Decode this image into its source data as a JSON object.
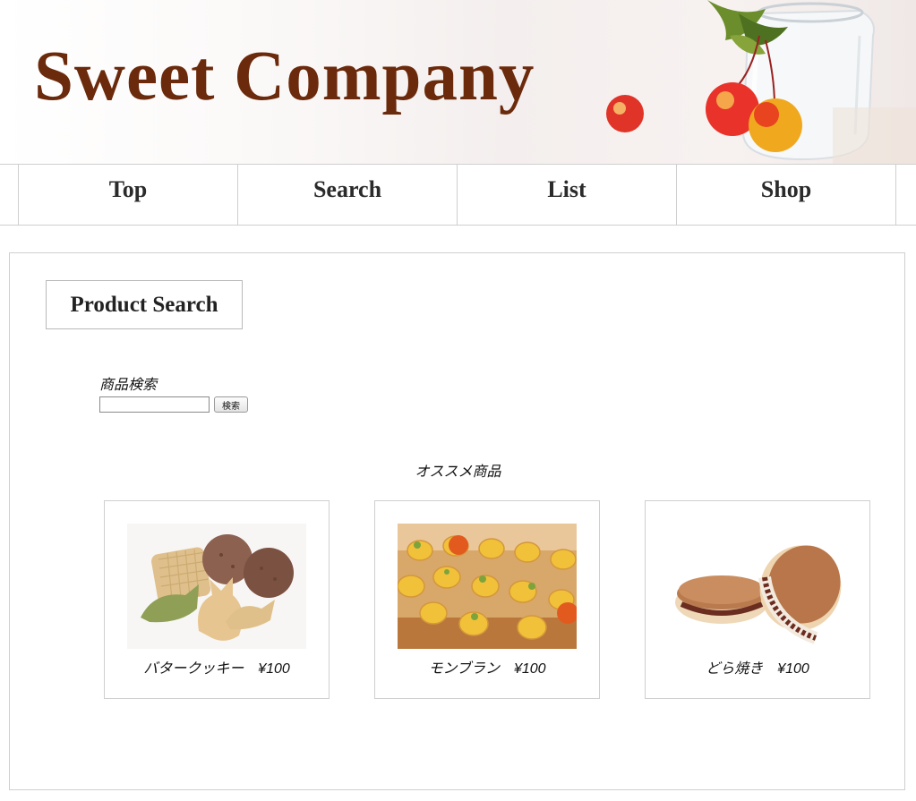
{
  "header": {
    "title": "Sweet Company"
  },
  "nav": {
    "items": [
      {
        "label": "Top"
      },
      {
        "label": "Search"
      },
      {
        "label": "List"
      },
      {
        "label": "Shop"
      }
    ]
  },
  "main": {
    "page_title": "Product Search",
    "search": {
      "label": "商品検索",
      "value": "",
      "placeholder": "",
      "button_label": "検索"
    },
    "recommended": {
      "title": "オススメ商品",
      "products": [
        {
          "name": "バタークッキー",
          "price": "¥100",
          "caption": "バタークッキー　¥100",
          "image_icon": "butter-cookie-image"
        },
        {
          "name": "モンブラン",
          "price": "¥100",
          "caption": "モンブラン　¥100",
          "image_icon": "mont-blanc-image"
        },
        {
          "name": "どら焼き",
          "price": "¥100",
          "caption": "どら焼き　¥100",
          "image_icon": "dorayaki-image"
        }
      ]
    }
  },
  "colors": {
    "brand_title": "#6b2a0c",
    "border": "#cfcfcf",
    "text": "#222222"
  }
}
